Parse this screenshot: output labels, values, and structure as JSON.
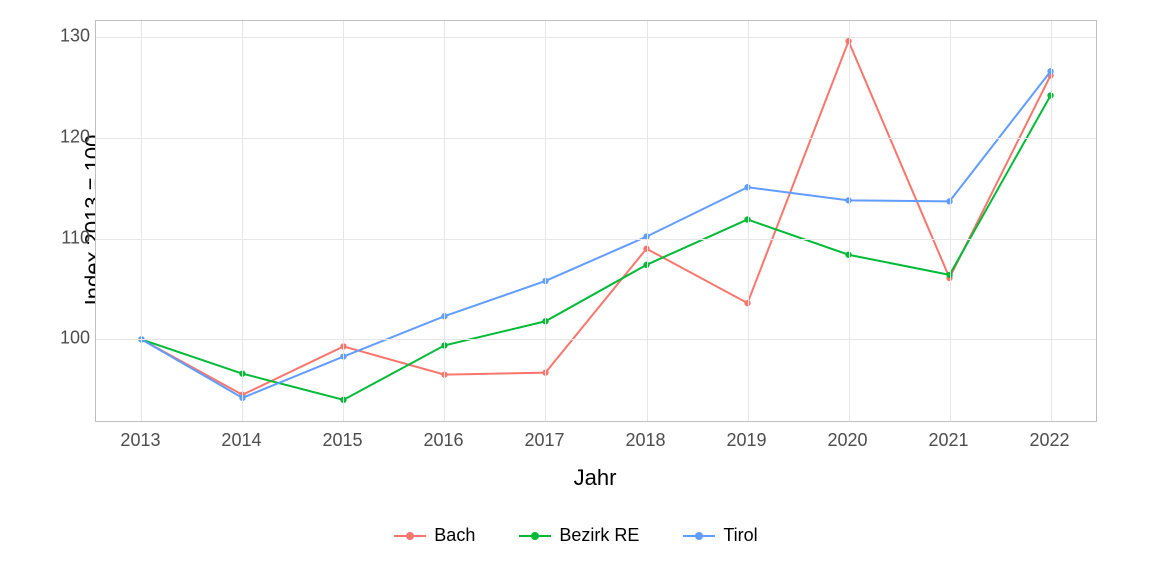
{
  "chart_data": {
    "type": "line",
    "title": "",
    "xlabel": "Jahr",
    "ylabel": "Index  2013  =  100",
    "x": [
      2013,
      2014,
      2015,
      2016,
      2017,
      2018,
      2019,
      2020,
      2021,
      2022
    ],
    "x_ticks": [
      2013,
      2014,
      2015,
      2016,
      2017,
      2018,
      2019,
      2020,
      2021,
      2022
    ],
    "y_ticks": [
      100,
      110,
      120,
      130
    ],
    "xlim": [
      2012.55,
      2022.45
    ],
    "ylim": [
      91.9,
      131.6
    ],
    "series": [
      {
        "name": "Bach",
        "color": "#F8766D",
        "values": [
          100.0,
          94.5,
          99.3,
          96.5,
          96.7,
          109.0,
          103.6,
          129.6,
          106.1,
          126.2
        ]
      },
      {
        "name": "Bezirk RE",
        "color": "#00BA38",
        "values": [
          100.0,
          96.6,
          94.0,
          99.4,
          101.8,
          107.4,
          111.9,
          108.4,
          106.4,
          124.2
        ]
      },
      {
        "name": "Tirol",
        "color": "#619CFF",
        "values": [
          100.0,
          94.2,
          98.3,
          102.3,
          105.8,
          110.2,
          115.1,
          113.8,
          113.7,
          126.6
        ]
      }
    ],
    "legend_position": "bottom",
    "grid": true
  },
  "legend": {
    "items": [
      {
        "label": "Bach"
      },
      {
        "label": "Bezirk RE"
      },
      {
        "label": "Tirol"
      }
    ]
  }
}
